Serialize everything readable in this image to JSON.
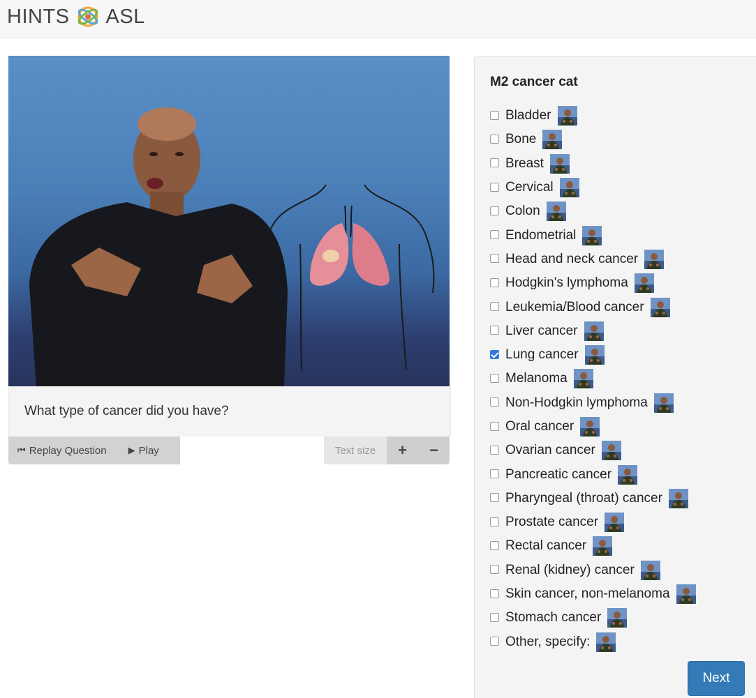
{
  "header": {
    "brand_left": "HINTS",
    "brand_right": "ASL",
    "logo_icon": "hints-asl-logo-icon"
  },
  "video": {
    "caption": "What type of cancer did you have?",
    "replay_label": "Replay Question",
    "play_label": "Play",
    "text_size_label": "Text size",
    "increase_label": "+",
    "decrease_label": "−"
  },
  "panel": {
    "title": "M2 cancer cat",
    "options": [
      {
        "label": "Bladder",
        "checked": false
      },
      {
        "label": "Bone",
        "checked": false
      },
      {
        "label": "Breast",
        "checked": false
      },
      {
        "label": "Cervical",
        "checked": false
      },
      {
        "label": "Colon",
        "checked": false
      },
      {
        "label": "Endometrial",
        "checked": false
      },
      {
        "label": "Head and neck cancer",
        "checked": false
      },
      {
        "label": "Hodgkin's lymphoma",
        "checked": false
      },
      {
        "label": "Leukemia/Blood cancer",
        "checked": false
      },
      {
        "label": "Liver cancer",
        "checked": false
      },
      {
        "label": "Lung cancer",
        "checked": true
      },
      {
        "label": "Melanoma",
        "checked": false
      },
      {
        "label": "Non-Hodgkin lymphoma",
        "checked": false
      },
      {
        "label": "Oral cancer",
        "checked": false
      },
      {
        "label": "Ovarian cancer",
        "checked": false
      },
      {
        "label": "Pancreatic cancer",
        "checked": false
      },
      {
        "label": "Pharyngeal (throat) cancer",
        "checked": false
      },
      {
        "label": "Prostate cancer",
        "checked": false
      },
      {
        "label": "Rectal cancer",
        "checked": false
      },
      {
        "label": "Renal (kidney) cancer",
        "checked": false
      },
      {
        "label": "Skin cancer, non-melanoma",
        "checked": false
      },
      {
        "label": "Stomach cancer",
        "checked": false
      },
      {
        "label": "Other, specify:",
        "checked": false
      }
    ],
    "next_label": "Next"
  },
  "colors": {
    "accent": "#337ab7",
    "checkbox_checked": "#2f7bdc",
    "video_bg": "#4b7fb8"
  }
}
